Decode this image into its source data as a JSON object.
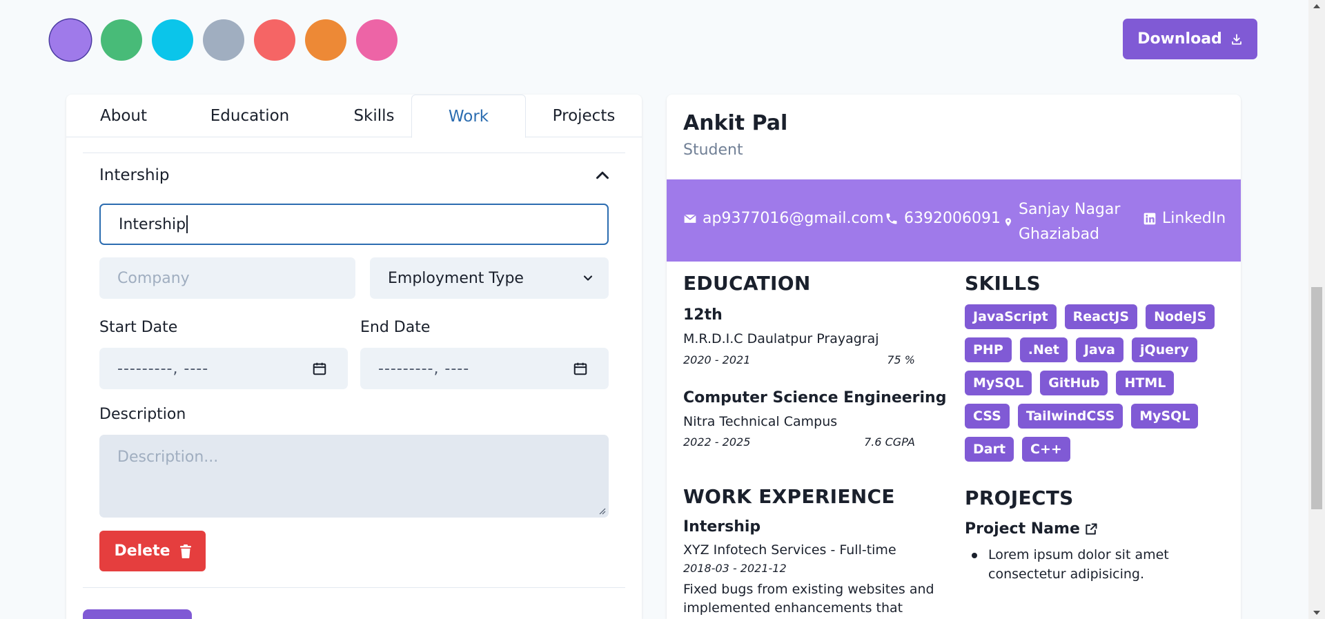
{
  "theme": {
    "colors": [
      "#9f7aea",
      "#48bb78",
      "#0bc5ea",
      "#a0aec0",
      "#f56565",
      "#ed8936",
      "#ed64a6"
    ],
    "selected_index": 0
  },
  "download": {
    "label": "Download",
    "icon": "download-icon"
  },
  "tabs": [
    {
      "label": "About"
    },
    {
      "label": "Education"
    },
    {
      "label": "Skills"
    },
    {
      "label": "Work"
    },
    {
      "label": "Projects"
    }
  ],
  "active_tab": "Work",
  "work_form": {
    "accordion_title": "Intership",
    "title_value": "Intership",
    "company_placeholder": "Company",
    "employment_type_selected": "Employment Type",
    "start_date_label": "Start Date",
    "end_date_label": "End Date",
    "start_date_value": "---------, ----",
    "end_date_value": "---------, ----",
    "description_label": "Description",
    "description_placeholder": "Description...",
    "delete_label": "Delete"
  },
  "preview": {
    "name": "Ankit Pal",
    "role": "Student",
    "contact": {
      "email": "ap9377016@gmail.com",
      "phone": "6392006091",
      "location_line1": "Sanjay Nagar",
      "location_line2": "Ghaziabad",
      "linkedin": "LinkedIn"
    },
    "education_heading": "EDUCATION",
    "education": [
      {
        "degree": "12th",
        "institution": "M.R.D.I.C Daulatpur Prayagraj",
        "years": "2020 - 2021",
        "grade": "75 %"
      },
      {
        "degree": "Computer Science Engineering",
        "institution": "Nitra Technical Campus",
        "years": "2022 - 2025",
        "grade": "7.6 CGPA"
      }
    ],
    "skills_heading": "SKILLS",
    "skills": [
      "JavaScript",
      "ReactJS",
      "NodeJS",
      "PHP",
      ".Net",
      "Java",
      "jQuery",
      "MySQL",
      "GitHub",
      "HTML",
      "CSS",
      "TailwindCSS",
      "MySQL",
      "Dart",
      "C++"
    ],
    "work_heading": "WORK EXPERIENCE",
    "work": {
      "title": "Intership",
      "company_line": "XYZ Infotech Services - Full-time",
      "dates": "2018-03 - 2021-12",
      "description": "Fixed bugs from existing websites and implemented enhancements that"
    },
    "projects_heading": "PROJECTS",
    "project": {
      "name": "Project Name",
      "bullet": "Lorem ipsum dolor sit amet consectetur adipisicing."
    }
  }
}
